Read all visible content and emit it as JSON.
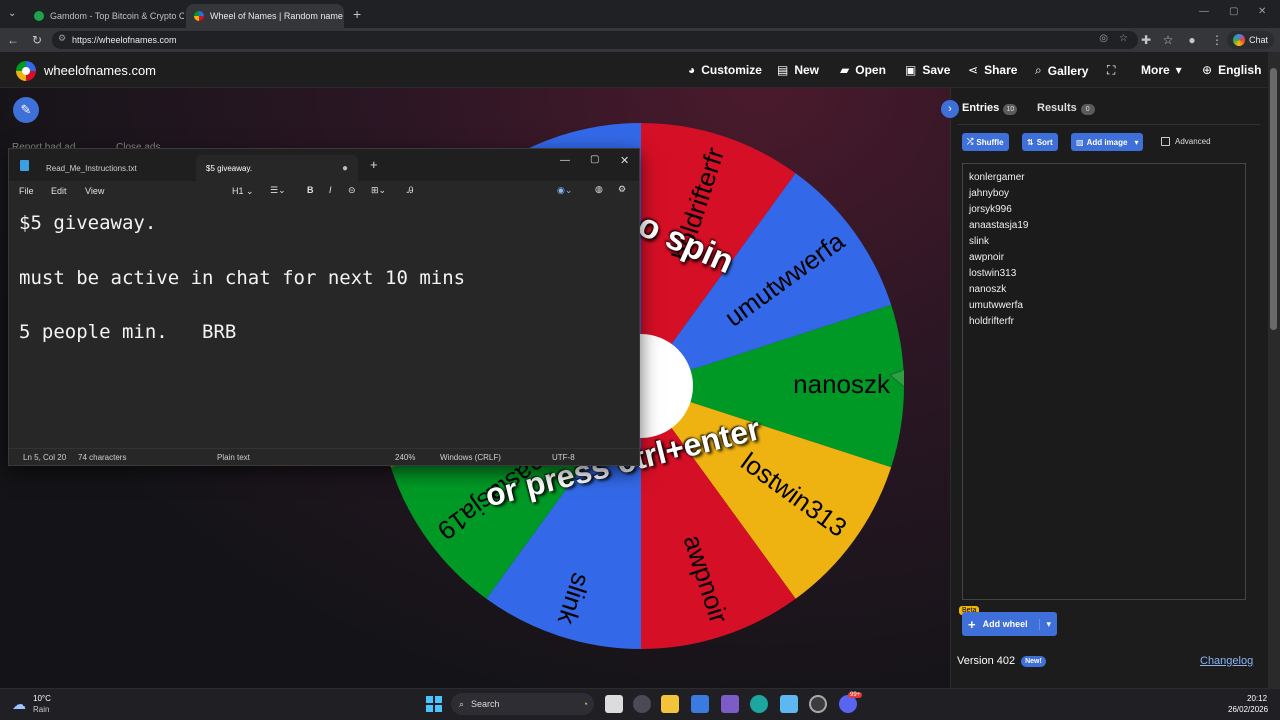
{
  "browser": {
    "tabs": [
      {
        "title": "Gamdom - Top Bitcoin & Crypto C",
        "favicon_color": "#1fa34a"
      },
      {
        "title": "Wheel of Names | Random name p",
        "favicon_color": "#e64a4a"
      }
    ],
    "url": "https://wheelofnames.com",
    "chat_label": "Chat"
  },
  "site": {
    "name": "wheelofnames.com",
    "nav": [
      {
        "label": "Customize",
        "icon": "palette-icon"
      },
      {
        "label": "New",
        "icon": "new-file-icon"
      },
      {
        "label": "Open",
        "icon": "folder-icon"
      },
      {
        "label": "Save",
        "icon": "save-icon"
      },
      {
        "label": "Share",
        "icon": "share-icon"
      },
      {
        "label": "Gallery",
        "icon": "search-icon"
      },
      {
        "label": "",
        "icon": "fullscreen-icon"
      },
      {
        "label": "More",
        "icon": "chevron-down-icon"
      },
      {
        "label": "English",
        "icon": "globe-icon"
      }
    ]
  },
  "wheel": {
    "overlay_top": "o spin",
    "overlay_bottom": "or press ctrl+enter",
    "behind_text_1": "Report bad ad",
    "behind_text_2": "Close ads",
    "segments": [
      {
        "name": "nanoszk",
        "color": "#009925"
      },
      {
        "name": "lostwin313",
        "color": "#eeb211"
      },
      {
        "name": "awpnoir",
        "color": "#d50f25"
      },
      {
        "name": "slink",
        "color": "#3369e8"
      },
      {
        "name": "anaastasja19",
        "color": "#009925"
      },
      {
        "name": "jorsyk996",
        "color": "#eeb211"
      },
      {
        "name": "jahnyboy",
        "color": "#d50f25"
      },
      {
        "name": "konlergamer",
        "color": "#3369e8"
      },
      {
        "name": "holdrifterfr",
        "color": "#d50f25"
      },
      {
        "name": "umutwwerfa",
        "color": "#3369e8"
      }
    ],
    "pointer_color": "#2ea043"
  },
  "notepad": {
    "tabs": [
      "Read_Me_Instructions.txt",
      "$5 giveaway."
    ],
    "menu": [
      "File",
      "Edit",
      "View"
    ],
    "heading_control": "H1",
    "lines": [
      "$5 giveaway.",
      "must be active in chat for next 10 mins",
      "5 people min.   BRB"
    ],
    "status": {
      "position": "Ln 5, Col 20",
      "chars": "74 characters",
      "format": "Plain text",
      "zoom": "240%",
      "line_ending": "Windows (CRLF)",
      "encoding": "UTF-8"
    }
  },
  "panel": {
    "tab_entries": "Entries",
    "entries_count": "10",
    "tab_results": "Results",
    "results_count": "0",
    "shuffle": "Shuffle",
    "sort": "Sort",
    "add_image": "Add image",
    "advanced": "Advanced",
    "entries": [
      "konlergamer",
      "jahnyboy",
      "jorsyk996",
      "anaastasja19",
      "slink",
      "awpnoir",
      "lostwin313",
      "nanoszk",
      "umutwwerfa",
      "holdrifterfr"
    ],
    "beta": "Beta",
    "add_wheel": "Add wheel",
    "version": "Version 402",
    "new_badge": "New!",
    "changelog": "Changelog"
  },
  "taskbar": {
    "temp": "10°C",
    "weather": "Rain",
    "search": "Search",
    "time": "20:12",
    "date": "26/02/2026",
    "discord_badge": "99+"
  }
}
